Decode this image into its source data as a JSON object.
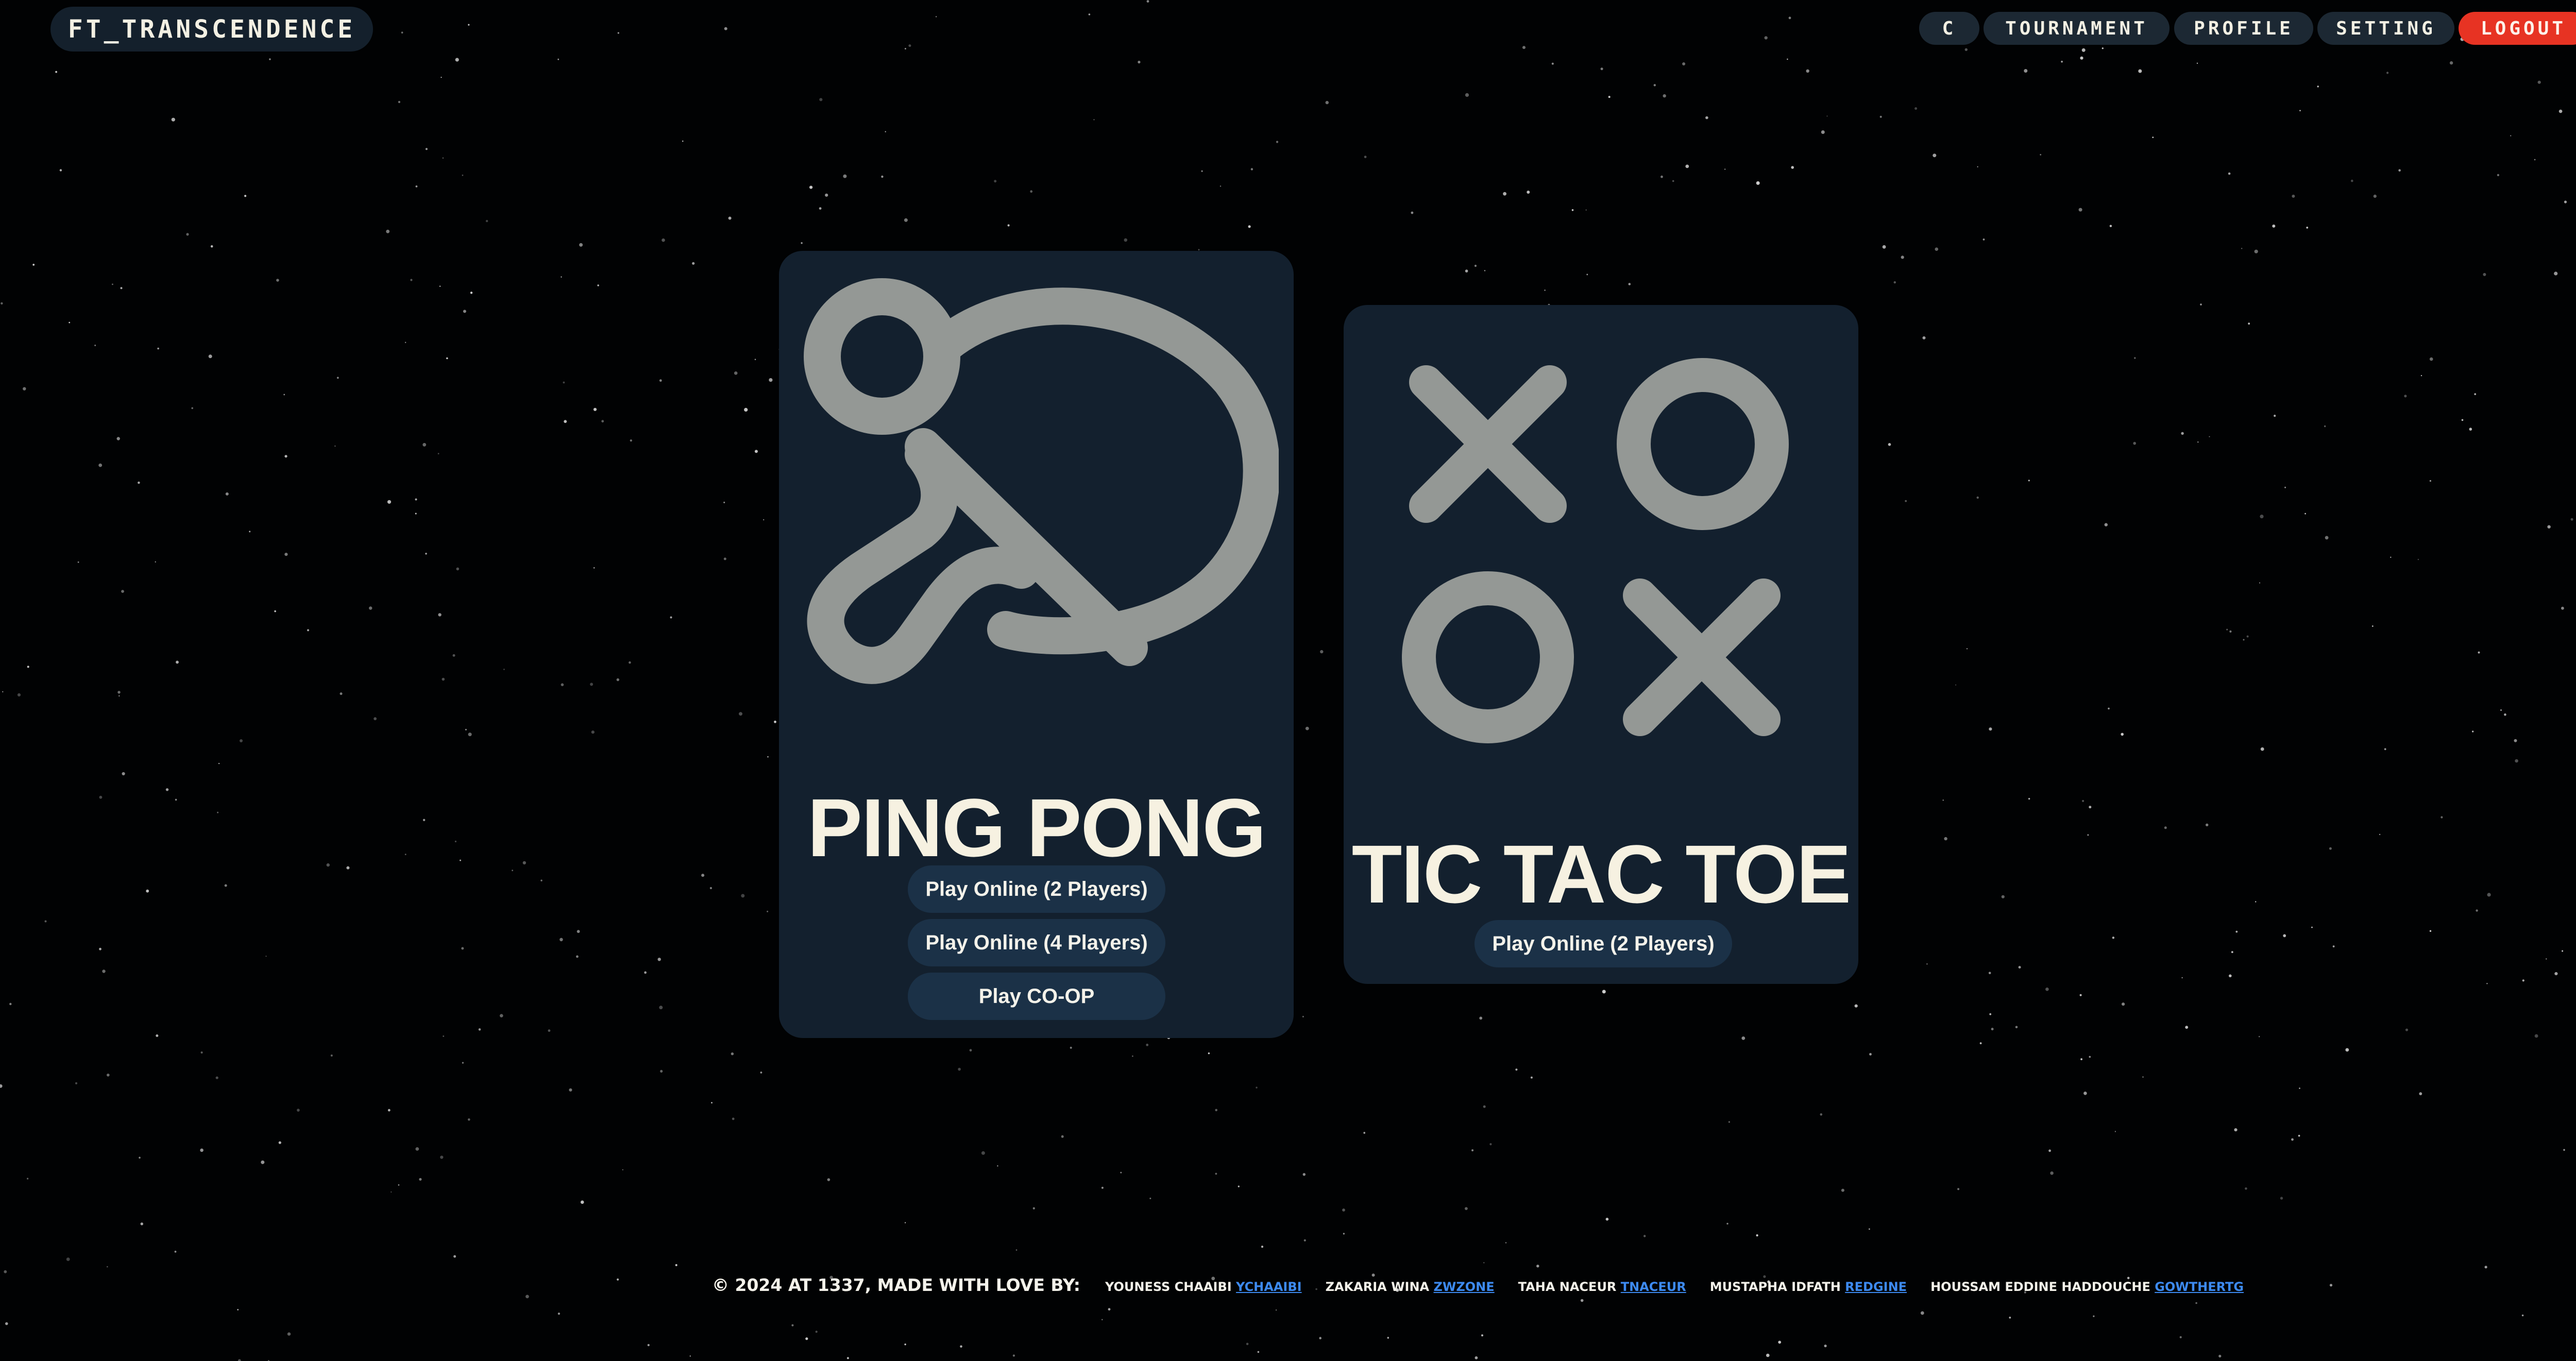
{
  "header": {
    "brand": "FT_TRANSCENDENCE",
    "nav": [
      {
        "label": "C",
        "name": "nav-c-button"
      },
      {
        "label": "TOURNAMENT",
        "name": "nav-tournament-button"
      },
      {
        "label": "PROFILE",
        "name": "nav-profile-button"
      },
      {
        "label": "SETTING",
        "name": "nav-setting-button"
      },
      {
        "label": "LOGOUT",
        "name": "logout-button"
      }
    ]
  },
  "games": [
    {
      "title": "PING PONG",
      "icon": "ping-pong-paddle-icon",
      "buttons": [
        "Play Online (2 Players)",
        "Play Online (4 Players)",
        "Play CO-OP"
      ]
    },
    {
      "title": "TIC TAC TOE",
      "icon": "tic-tac-toe-icon",
      "buttons": [
        "Play Online (2 Players)"
      ]
    }
  ],
  "footer": {
    "copyright": "© 2024 AT 1337, MADE WITH LOVE BY:",
    "authors": [
      {
        "name": "YOUNESS CHAAIBI",
        "handle": "YCHAAIBI"
      },
      {
        "name": "ZAKARIA WINA",
        "handle": "ZWZONE"
      },
      {
        "name": "TAHA NACEUR",
        "handle": "TNACEUR"
      },
      {
        "name": "MUSTAPHA IDFATH",
        "handle": "REDGINE"
      },
      {
        "name": "HOUSSAM EDDINE HADDOUCHE",
        "handle": "GOWTHERTG"
      }
    ]
  },
  "colors": {
    "background": "#010203",
    "card": "#13202e",
    "button": "#1b3147",
    "nav_button": "#1c2833",
    "logout": "#e73323",
    "icon": "#949895",
    "link": "#3d8af0",
    "text": "#f6f1e1"
  }
}
